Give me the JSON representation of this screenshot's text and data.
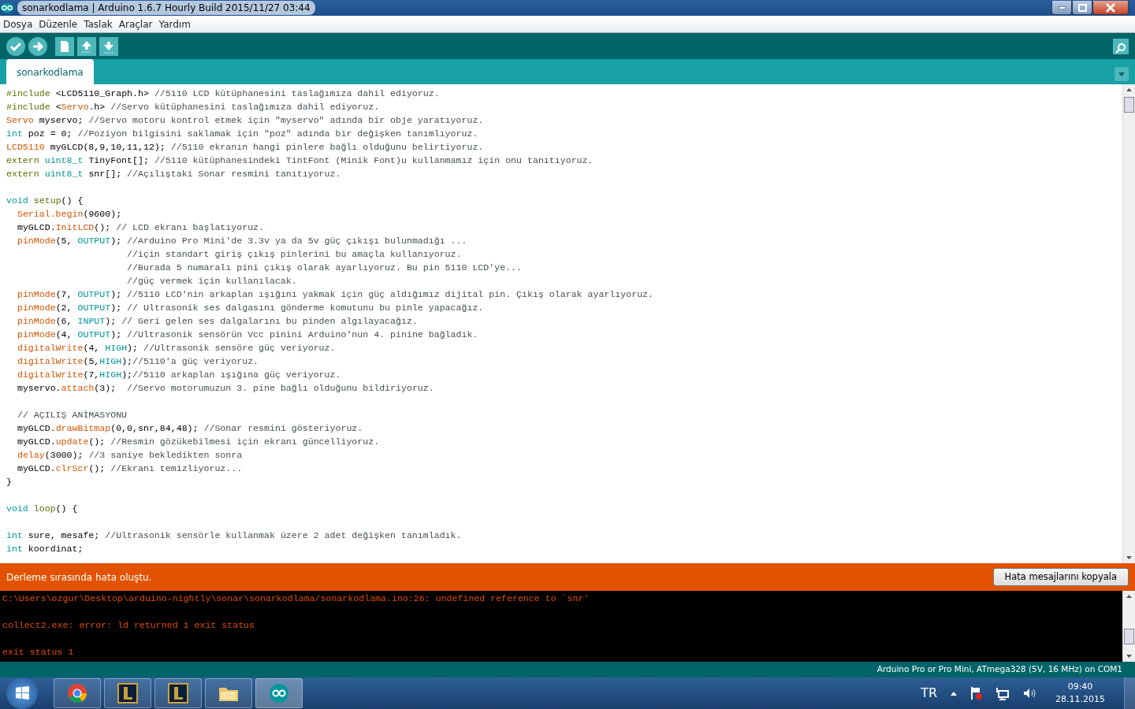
{
  "window": {
    "title": "sonarkodlama | Arduino 1.6.7 Hourly Build 2015/11/27 03:44"
  },
  "menu": [
    "Dosya",
    "Düzenle",
    "Taslak",
    "Araçlar",
    "Yardım"
  ],
  "toolbar": [
    {
      "kind": "verify"
    },
    {
      "kind": "upload"
    },
    {
      "kind": "new"
    },
    {
      "kind": "open"
    },
    {
      "kind": "save"
    }
  ],
  "tabs": [
    {
      "label": "sonarkodlama",
      "selected": true
    }
  ],
  "editor": {
    "lines": [
      {
        "kind": "code",
        "segments": [
          {
            "text": "#include",
            "kind": "pre"
          },
          {
            "text": " <LCD5110_Graph.h> ",
            "kind": "plain"
          },
          {
            "text": "//5110 LCD kütüphanesini taslağımıza dahil ediyoruz.",
            "kind": "comment"
          }
        ]
      },
      {
        "kind": "code",
        "segments": [
          {
            "text": "#include",
            "kind": "pre"
          },
          {
            "text": " <",
            "kind": "plain"
          },
          {
            "text": "Servo",
            "kind": "func"
          },
          {
            "text": ".h> ",
            "kind": "plain"
          },
          {
            "text": "//Servo kütüphanesini taslağımıza dahil ediyoruz.",
            "kind": "comment"
          }
        ]
      },
      {
        "kind": "code",
        "segments": [
          {
            "text": "Servo",
            "kind": "func"
          },
          {
            "text": " myservo; ",
            "kind": "plain"
          },
          {
            "text": "//Servo motoru kontrol etmek için \"myservo\" adında bir obje yaratıyoruz.",
            "kind": "comment"
          }
        ]
      },
      {
        "kind": "code",
        "segments": [
          {
            "text": "int",
            "kind": "type"
          },
          {
            "text": " poz = 0; ",
            "kind": "plain"
          },
          {
            "text": "//Poziyon bilgisini saklamak için \"poz\" adında bir değişken tanımlıyoruz.",
            "kind": "comment"
          }
        ]
      },
      {
        "kind": "code",
        "segments": [
          {
            "text": "LCD5110",
            "kind": "func"
          },
          {
            "text": " myGLCD(8,9,10,11,12); ",
            "kind": "plain"
          },
          {
            "text": "//5110 ekranın hangi pinlere bağlı olduğunu belirtiyoruz.",
            "kind": "comment"
          }
        ]
      },
      {
        "kind": "code",
        "segments": [
          {
            "text": "extern ",
            "kind": "pre"
          },
          {
            "text": "uint8_t",
            "kind": "type"
          },
          {
            "text": " TinyFont[]; ",
            "kind": "plain"
          },
          {
            "text": "//5110 kütüphanesindeki TintFont (Minik Font)u kullanmamız için onu tanıtıyoruz.",
            "kind": "comment"
          }
        ]
      },
      {
        "kind": "code",
        "segments": [
          {
            "text": "extern ",
            "kind": "pre"
          },
          {
            "text": "uint8_t",
            "kind": "type"
          },
          {
            "text": " snr[]; ",
            "kind": "plain"
          },
          {
            "text": "//Açılıştaki Sonar resmini tanıtıyoruz.",
            "kind": "comment"
          }
        ]
      },
      {
        "kind": "blank"
      },
      {
        "kind": "code",
        "segments": [
          {
            "text": "void ",
            "kind": "type"
          },
          {
            "text": "setup",
            "kind": "pre"
          },
          {
            "text": "() {",
            "kind": "plain"
          }
        ]
      },
      {
        "kind": "code",
        "segments": [
          {
            "text": "  Serial.begin",
            "kind": "func"
          },
          {
            "text": "(9600);",
            "kind": "plain"
          }
        ]
      },
      {
        "kind": "code",
        "segments": [
          {
            "text": "  myGLCD.",
            "kind": "plain"
          },
          {
            "text": "InitLCD",
            "kind": "func"
          },
          {
            "text": "(); ",
            "kind": "plain"
          },
          {
            "text": "// LCD ekranı başlatıyoruz.",
            "kind": "comment"
          }
        ]
      },
      {
        "kind": "code",
        "segments": [
          {
            "text": "  pinMode",
            "kind": "func"
          },
          {
            "text": "(5, ",
            "kind": "plain"
          },
          {
            "text": "OUTPUT",
            "kind": "type"
          },
          {
            "text": "); ",
            "kind": "plain"
          },
          {
            "text": "//Arduino Pro Mini'de 3.3v ya da 5v güç çıkışı bulunmadığı ...",
            "kind": "comment"
          }
        ]
      },
      {
        "kind": "code",
        "segments": [
          {
            "text": "                      //için standart giriş çıkış pinlerini bu amaçla kullanıyoruz.",
            "kind": "comment"
          }
        ]
      },
      {
        "kind": "code",
        "segments": [
          {
            "text": "                      //Burada 5 numaralı pini çıkış olarak ayarlıyoruz. Bu pin 5110 LCD'ye...",
            "kind": "comment"
          }
        ]
      },
      {
        "kind": "code",
        "segments": [
          {
            "text": "                      //güç vermek için kullanılacak.",
            "kind": "comment"
          }
        ]
      },
      {
        "kind": "code",
        "segments": [
          {
            "text": "  pinMode",
            "kind": "func"
          },
          {
            "text": "(7, ",
            "kind": "plain"
          },
          {
            "text": "OUTPUT",
            "kind": "type"
          },
          {
            "text": "); ",
            "kind": "plain"
          },
          {
            "text": "//5110 LCD'nin arkaplan ışığını yakmak için güç aldığımız dijital pin. Çıkış olarak ayarlıyoruz.",
            "kind": "comment"
          }
        ]
      },
      {
        "kind": "code",
        "segments": [
          {
            "text": "  pinMode",
            "kind": "func"
          },
          {
            "text": "(2, ",
            "kind": "plain"
          },
          {
            "text": "OUTPUT",
            "kind": "type"
          },
          {
            "text": "); ",
            "kind": "plain"
          },
          {
            "text": "// Ultrasonik ses dalgasını gönderme komutunu bu pinle yapacağız.",
            "kind": "comment"
          }
        ]
      },
      {
        "kind": "code",
        "segments": [
          {
            "text": "  pinMode",
            "kind": "func"
          },
          {
            "text": "(6, ",
            "kind": "plain"
          },
          {
            "text": "INPUT",
            "kind": "type"
          },
          {
            "text": "); ",
            "kind": "plain"
          },
          {
            "text": "// Geri gelen ses dalgalarını bu pinden algılayacağız.",
            "kind": "comment"
          }
        ]
      },
      {
        "kind": "code",
        "segments": [
          {
            "text": "  pinMode",
            "kind": "func"
          },
          {
            "text": "(4, ",
            "kind": "plain"
          },
          {
            "text": "OUTPUT",
            "kind": "type"
          },
          {
            "text": "); ",
            "kind": "plain"
          },
          {
            "text": "//Ultrasonik sensörün Vcc pinini Arduino'nun 4. pinine bağladık.",
            "kind": "comment"
          }
        ]
      },
      {
        "kind": "code",
        "segments": [
          {
            "text": "  digitalWrite",
            "kind": "func"
          },
          {
            "text": "(4, ",
            "kind": "plain"
          },
          {
            "text": "HIGH",
            "kind": "type"
          },
          {
            "text": "); ",
            "kind": "plain"
          },
          {
            "text": "//Ultrasonik sensöre güç veriyoruz.",
            "kind": "comment"
          }
        ]
      },
      {
        "kind": "code",
        "segments": [
          {
            "text": "  digitalWrite",
            "kind": "func"
          },
          {
            "text": "(5,",
            "kind": "plain"
          },
          {
            "text": "HIGH",
            "kind": "type"
          },
          {
            "text": ");",
            "kind": "plain"
          },
          {
            "text": "//5110'a güç veriyoruz.",
            "kind": "comment"
          }
        ]
      },
      {
        "kind": "code",
        "segments": [
          {
            "text": "  digitalWrite",
            "kind": "func"
          },
          {
            "text": "(7,",
            "kind": "plain"
          },
          {
            "text": "HIGH",
            "kind": "type"
          },
          {
            "text": ");",
            "kind": "plain"
          },
          {
            "text": "//5110 arkaplan ışığına güç veriyoruz.",
            "kind": "comment"
          }
        ]
      },
      {
        "kind": "code",
        "segments": [
          {
            "text": "  myservo.",
            "kind": "plain"
          },
          {
            "text": "attach",
            "kind": "func"
          },
          {
            "text": "(3);  ",
            "kind": "plain"
          },
          {
            "text": "//Servo motorumuzun 3. pine bağlı olduğunu bildiriyoruz.",
            "kind": "comment"
          }
        ]
      },
      {
        "kind": "blank"
      },
      {
        "kind": "code",
        "segments": [
          {
            "text": "  // AÇILIŞ ANİMASYONU",
            "kind": "comment"
          }
        ]
      },
      {
        "kind": "code",
        "segments": [
          {
            "text": "  myGLCD.",
            "kind": "plain"
          },
          {
            "text": "drawBitmap",
            "kind": "func"
          },
          {
            "text": "(0,0,snr,84,48); ",
            "kind": "plain"
          },
          {
            "text": "//Sonar resmini gösteriyoruz.",
            "kind": "comment"
          }
        ]
      },
      {
        "kind": "code",
        "segments": [
          {
            "text": "  myGLCD.",
            "kind": "plain"
          },
          {
            "text": "update",
            "kind": "func"
          },
          {
            "text": "(); ",
            "kind": "plain"
          },
          {
            "text": "//Resmin gözükebilmesi için ekranı güncelliyoruz.",
            "kind": "comment"
          }
        ]
      },
      {
        "kind": "code",
        "segments": [
          {
            "text": "  delay",
            "kind": "func"
          },
          {
            "text": "(3000); ",
            "kind": "plain"
          },
          {
            "text": "//3 saniye bekledikten sonra",
            "kind": "comment"
          }
        ]
      },
      {
        "kind": "code",
        "segments": [
          {
            "text": "  myGLCD.",
            "kind": "plain"
          },
          {
            "text": "clrScr",
            "kind": "func"
          },
          {
            "text": "(); ",
            "kind": "plain"
          },
          {
            "text": "//Ekranı temizliyoruz...",
            "kind": "comment"
          }
        ]
      },
      {
        "kind": "code",
        "segments": [
          {
            "text": "}",
            "kind": "plain"
          }
        ]
      },
      {
        "kind": "blank"
      },
      {
        "kind": "code",
        "segments": [
          {
            "text": "void ",
            "kind": "type"
          },
          {
            "text": "loop",
            "kind": "pre"
          },
          {
            "text": "() {",
            "kind": "plain"
          }
        ]
      },
      {
        "kind": "blank"
      },
      {
        "kind": "code",
        "segments": [
          {
            "text": "int",
            "kind": "type"
          },
          {
            "text": " sure, mesafe; ",
            "kind": "plain"
          },
          {
            "text": "//Ultrasonik sensörle kullanmak üzere 2 adet değişken tanımladık.",
            "kind": "comment"
          }
        ]
      },
      {
        "kind": "code",
        "segments": [
          {
            "text": "int",
            "kind": "type"
          },
          {
            "text": " koordinat;",
            "kind": "plain"
          }
        ]
      }
    ]
  },
  "error_bar": {
    "message": "Derleme sırasında hata oluştu.",
    "button": "Hata mesajlarını kopyala"
  },
  "console": {
    "lines": [
      {
        "kind": "text",
        "text": "C:\\Users\\ozgur\\Desktop\\arduino-nightly\\sonar\\sonarkodlama/sonarkodlama.ino:26: undefined reference to `snr'"
      },
      {
        "kind": "blank"
      },
      {
        "kind": "text",
        "text": "collect2.exe: error: ld returned 1 exit status"
      },
      {
        "kind": "blank"
      },
      {
        "kind": "text",
        "text": "exit status 1"
      }
    ]
  },
  "status_bar": {
    "board": "Arduino Pro or Pro Mini, ATmega328 (5V, 16 MHz) on COM1"
  },
  "taskbar": {
    "apps": [
      {
        "kind": "chrome"
      },
      {
        "kind": "league"
      },
      {
        "kind": "league"
      },
      {
        "kind": "folder"
      },
      {
        "kind": "arduino",
        "selected": true
      }
    ],
    "language": "TR",
    "time": "09:40",
    "date": "28.11.2015"
  }
}
